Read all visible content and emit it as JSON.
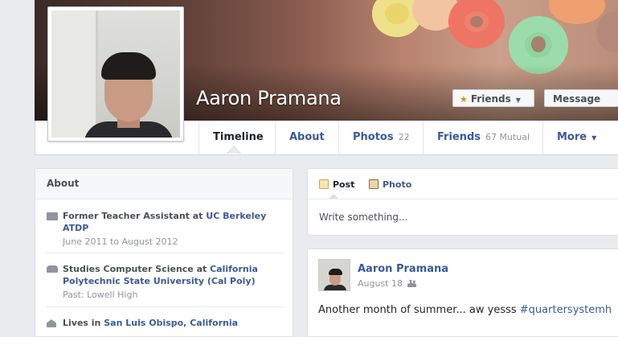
{
  "profile": {
    "name": "Aaron Pramana",
    "friends_button": "Friends",
    "message_button": "Message"
  },
  "nav": {
    "tabs": [
      {
        "label": "Timeline",
        "count": ""
      },
      {
        "label": "About",
        "count": ""
      },
      {
        "label": "Photos",
        "count": "22"
      },
      {
        "label": "Friends",
        "count": "67 Mutual"
      },
      {
        "label": "More",
        "count": ""
      }
    ]
  },
  "about": {
    "title": "About",
    "items": [
      {
        "icon": "briefcase-icon",
        "prefix": "Former Teacher Assistant at ",
        "link": "UC Berkeley ATDP",
        "sub": "June 2011 to August 2012"
      },
      {
        "icon": "school-icon",
        "prefix": "Studies Computer Science at ",
        "link": "California Polytechnic State University (Cal Poly)",
        "sub": "Past: Lowell High"
      },
      {
        "icon": "home-icon",
        "prefix": "Lives in ",
        "link": "San Luis Obispo, California",
        "sub": ""
      }
    ]
  },
  "composer": {
    "post_tab": "Post",
    "photo_tab": "Photo",
    "placeholder": "Write something..."
  },
  "post": {
    "author": "Aaron Pramana",
    "date": "August 18",
    "text": "Another month of summer... aw yesss ",
    "hashtag": "#quartersystemh"
  },
  "colors": {
    "link": "#3b5998",
    "background": "#e9ebee",
    "text": "#1d2129",
    "muted": "#90949c"
  }
}
